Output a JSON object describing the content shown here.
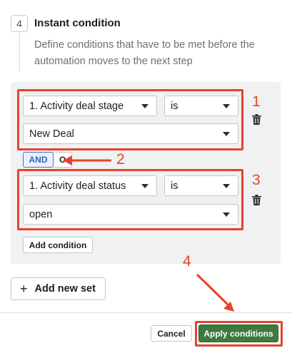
{
  "step": {
    "number": "4",
    "title": "Instant condition",
    "description": "Define conditions that have to be met before the automation moves to the next step"
  },
  "condition_set": {
    "conditions": [
      {
        "field": "1. Activity deal stage",
        "operator": "is",
        "value": "New Deal"
      },
      {
        "field": "1. Activity deal status",
        "operator": "is",
        "value": "open"
      }
    ],
    "logic_and_label": "AND",
    "logic_or_label": "O",
    "add_condition_label": "Add condition"
  },
  "add_new_set_label": "Add new set",
  "footer": {
    "cancel_label": "Cancel",
    "apply_label": "Apply conditions"
  },
  "annotations": [
    "1",
    "2",
    "3",
    "4"
  ],
  "colors": {
    "annotation_red": "#e5432e",
    "apply_green": "#3c7a3f",
    "and_blue": "#2f64c6"
  },
  "icons": {
    "dropdown": "chevron-down-icon",
    "delete": "trash-icon",
    "add": "plus-icon"
  }
}
